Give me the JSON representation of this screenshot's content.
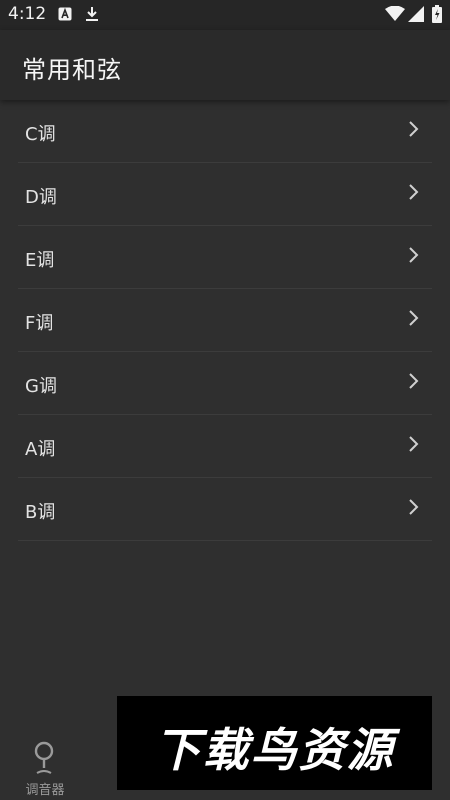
{
  "status_bar": {
    "time": "4:12"
  },
  "header": {
    "title": "常用和弦"
  },
  "list": {
    "items": [
      {
        "label": "C调"
      },
      {
        "label": "D调"
      },
      {
        "label": "E调"
      },
      {
        "label": "F调"
      },
      {
        "label": "G调"
      },
      {
        "label": "A调"
      },
      {
        "label": "B调"
      }
    ]
  },
  "bottom_nav": {
    "items": [
      {
        "label": "调音器",
        "icon": "tuner-icon"
      }
    ]
  },
  "watermark": {
    "text": "下载鸟资源"
  },
  "colors": {
    "background": "#2f2f2f",
    "app_bar": "#2a2a2a",
    "status_bar": "#262626",
    "divider": "#3c3c3c",
    "text": "#e3e3e3",
    "nav_label": "#9a9a9a"
  }
}
